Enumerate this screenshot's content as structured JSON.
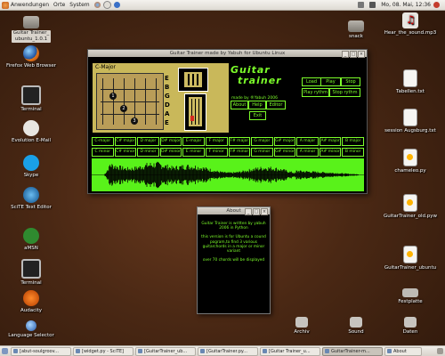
{
  "top_panel": {
    "menus": [
      "Anwendungen",
      "Orte",
      "System"
    ],
    "clock": "Mo, 08. Mai, 12:36"
  },
  "desktop_left": [
    {
      "label": "Guitar Trainer_\nubuntu_1.0.1",
      "icon": "folder-icon",
      "boxed": true
    },
    {
      "label": "Firefox Web Browser",
      "icon": "firefox-icon"
    },
    {
      "label": "Terminal",
      "icon": "terminal-icon"
    },
    {
      "label": "Evolution E-Mail",
      "icon": "evolution-icon"
    },
    {
      "label": "Skype",
      "icon": "skype-icon"
    },
    {
      "label": "SciTE Text Editor",
      "icon": "scite-icon"
    },
    {
      "label": "aMSN",
      "icon": "amsn-icon"
    },
    {
      "label": "Terminal",
      "icon": "terminal-icon"
    },
    {
      "label": "Audacity",
      "icon": "audacity-icon"
    },
    {
      "label": "Language Selector",
      "icon": "language-icon"
    }
  ],
  "desktop_right": [
    {
      "label": "Hear_the_sound.mp3",
      "icon": "audio-file-icon"
    },
    {
      "label": "Tabellen.txt",
      "icon": "text-file-icon"
    },
    {
      "label": "session Augsburg.txt",
      "icon": "text-file-icon"
    },
    {
      "label": "chameleo.py",
      "icon": "python-file-icon"
    },
    {
      "label": "GuitarTrainer_old.pyw",
      "icon": "python-file-icon"
    },
    {
      "label": "GuitarTrainer_ubuntu",
      "icon": "python-file-icon"
    },
    {
      "label": "Festplatte",
      "icon": "harddisk-icon"
    },
    {
      "label": "Daten",
      "icon": "drive-icon"
    }
  ],
  "desktop_misc": {
    "snack": "snack",
    "archiv": "Archiv",
    "sound": "Sound"
  },
  "main_window": {
    "title": "Guitar Trainer made by Yabuh for Ubuntu Linux",
    "chord_name": "C-Major",
    "string_labels": [
      "E",
      "B",
      "G",
      "D",
      "A",
      "E"
    ],
    "fingers": [
      "1",
      "2",
      "3"
    ],
    "logo_line1": "Guitar",
    "logo_line2": "trainer",
    "credit": "made by ®Yabuh 2006",
    "buttons": {
      "load": "Load",
      "play": "Play",
      "stop": "Stop",
      "play_rythm": "Play rythm",
      "stop_rythm": "Stop rythm",
      "about": "About",
      "help": "Help",
      "editor": "Editor",
      "exit": "Exit"
    },
    "chords": [
      "C-major",
      "C# major",
      "D major",
      "D# major",
      "E-major",
      "F major",
      "F# major",
      "G major",
      "G# major",
      "A major",
      "A# major",
      "B major",
      "C minor",
      "C# minor",
      "D minor",
      "D# minor",
      "E minor",
      "F minor",
      "F# minor",
      "G minor",
      "G# minor",
      "A minor",
      "A# minor",
      "B minor"
    ]
  },
  "about_dialog": {
    "title": "About",
    "line1": "Guitar Trainer is written by yabuh 2006 in Python",
    "line2": "this version is for Ubuntu a cound pogram,to find 3 various guitarchords in a major or minor variant",
    "line3": "over 70 chords will be displayed"
  },
  "taskbar": [
    {
      "label": "[abut-soulgroov...",
      "active": false
    },
    {
      "label": "[widget.py - SciTE]",
      "active": false
    },
    {
      "label": "[GuitarTrainer_ub...",
      "active": false
    },
    {
      "label": "[GuitarTrainer.py...",
      "active": false
    },
    {
      "label": "[Guitar Trainer_u...",
      "active": false
    },
    {
      "label": "GuitarTrainer-m...",
      "active": true
    },
    {
      "label": "About",
      "active": false
    }
  ],
  "colors": {
    "neon_green": "#7cfd2a",
    "wave_bg": "#59f21a",
    "chord_panel": "#c9b85a"
  }
}
